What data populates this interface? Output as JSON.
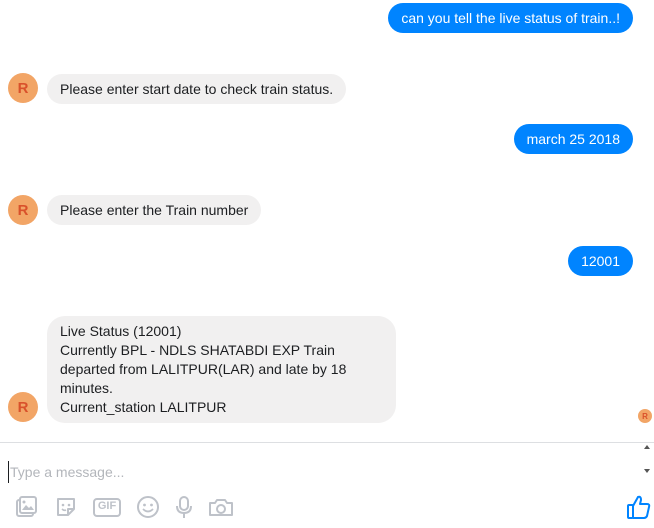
{
  "messages": [
    {
      "side": "out",
      "text": "can you tell the live status of train..!"
    },
    {
      "side": "in",
      "text": "Please enter start date to check train status."
    },
    {
      "side": "out",
      "text": "march 25 2018"
    },
    {
      "side": "in",
      "text": "Please enter the Train number"
    },
    {
      "side": "out",
      "text": "12001"
    },
    {
      "side": "in",
      "lines": [
        "Live Status (12001)",
        "Currently BPL - NDLS SHATABDI EXP Train",
        "departed from LALITPUR(LAR) and late by 18",
        "minutes.",
        "Current_station LALITPUR"
      ]
    }
  ],
  "avatar": {
    "initial": "R",
    "color": "#f2a566",
    "text_color": "#d9512b"
  },
  "composer": {
    "placeholder": "Type a message..."
  },
  "toolbar": {
    "gif_label": "GIF",
    "icons": [
      "image-icon",
      "sticker-icon",
      "gif-icon",
      "emoji-icon",
      "microphone-icon",
      "camera-icon",
      "thumbs-up-icon"
    ]
  },
  "colors": {
    "outgoing": "#0084ff",
    "incoming": "#f1f0f0",
    "icon": "#bec2c9",
    "like": "#0084ff"
  }
}
